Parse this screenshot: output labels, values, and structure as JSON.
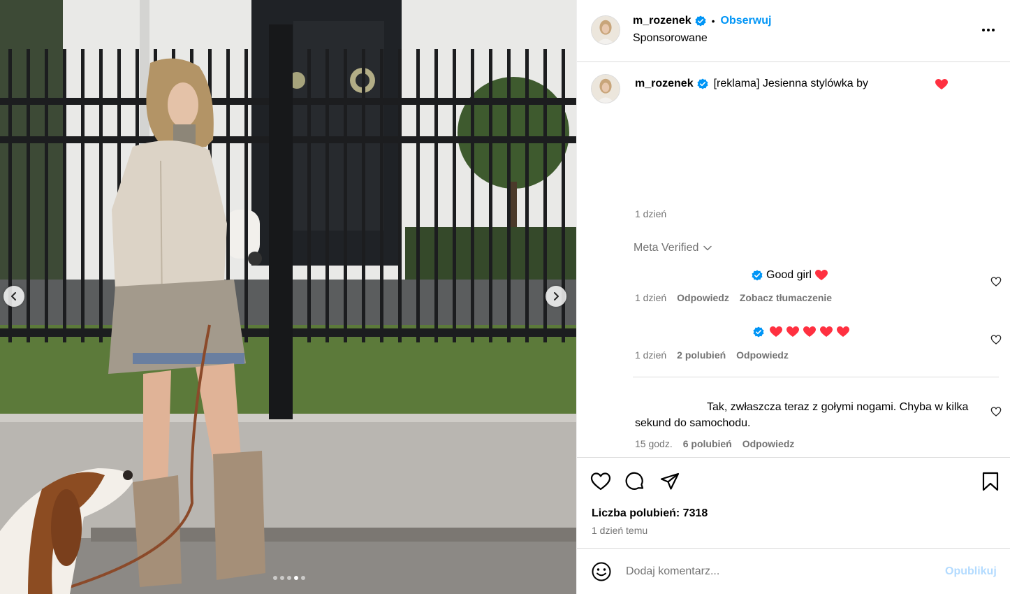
{
  "post": {
    "username": "m_rozenek",
    "bullet": "•",
    "follow_label": "Obserwuj",
    "sponsored_label": "Sponsorowane",
    "more_icon": "more-horizontal-icon",
    "verified_icon": "verified-badge-icon"
  },
  "caption": {
    "username": "m_rozenek",
    "text": "[reklama] Jesienna stylówka by",
    "emoji": "red-heart",
    "time": "1 dzień"
  },
  "meta_verified": {
    "label": "Meta Verified"
  },
  "comments": [
    {
      "text": "Good girl",
      "emoji": [
        "red-heart"
      ],
      "time": "1 dzień",
      "reply_label": "Odpowiedz",
      "translate_label": "Zobacz tłumaczenie"
    },
    {
      "emoji": [
        "red-heart",
        "red-heart",
        "red-heart",
        "red-heart",
        "red-heart"
      ],
      "time": "1 dzień",
      "likes_label": "2 polubień",
      "reply_label": "Odpowiedz"
    },
    {
      "text": "Tak, zwłaszcza teraz z gołymi nogami. Chyba w kilka sekund do samochodu.",
      "time": "15 godz.",
      "likes_label": "6 polubień",
      "reply_label": "Odpowiedz"
    }
  ],
  "actions": {
    "icons": [
      "like-icon",
      "comment-icon",
      "share-icon",
      "save-icon"
    ],
    "likes_text": "Liczba polubień: 7318",
    "posted_text": "1 dzień temu"
  },
  "composer": {
    "placeholder": "Dodaj komentarz...",
    "post_label": "Opublikuj"
  },
  "carousel": {
    "slide_count": 5,
    "active_index": 3
  },
  "colors": {
    "accent": "#0095f6",
    "heart": "#ff3040",
    "muted": "#737373",
    "border": "#dbdbdb",
    "post_disabled": "#b3dbff"
  }
}
